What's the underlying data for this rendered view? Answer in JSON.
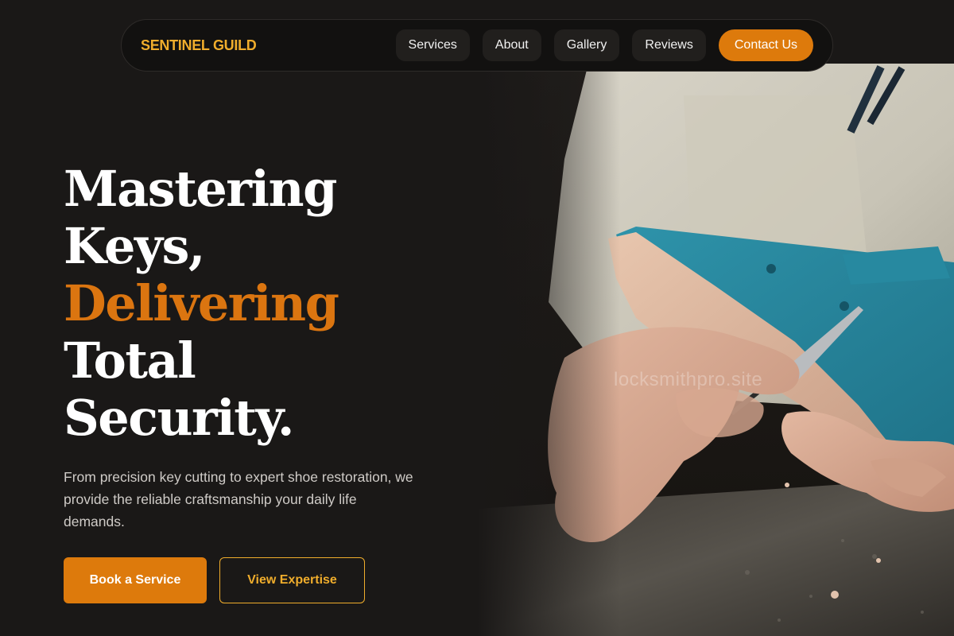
{
  "brand": {
    "name": "SENTINEL GUILD",
    "accent": "#f0ad2c",
    "cta_color": "#dd7a0c"
  },
  "nav": {
    "links": [
      "Services",
      "About",
      "Gallery",
      "Reviews"
    ],
    "cta": "Contact Us"
  },
  "hero": {
    "headline": {
      "line1": "Mastering",
      "line2": "Keys,",
      "line3": "Delivering",
      "line4": "Total",
      "line5": "Security."
    },
    "lead": "From precision key cutting to expert shoe restoration, we provide the reliable craftsmanship your daily life demands.",
    "primary_button": "Book a Service",
    "secondary_button": "View Expertise",
    "image": {
      "subject": "craftsman carving a shoe last",
      "watermark": "locksmithpro.site"
    }
  }
}
